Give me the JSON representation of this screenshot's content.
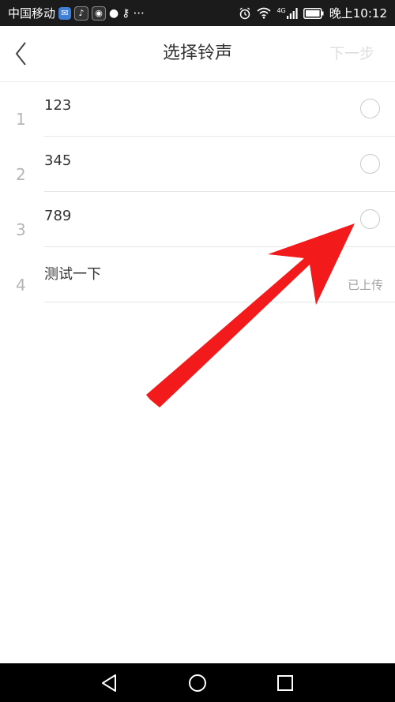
{
  "status_bar": {
    "carrier": "中国移动",
    "more": "···",
    "network": "4G",
    "time": "晚上10:12"
  },
  "header": {
    "title": "选择铃声",
    "next_label": "下一步"
  },
  "ringtones": [
    {
      "index": "1",
      "name": "123",
      "status": ""
    },
    {
      "index": "2",
      "name": "345",
      "status": ""
    },
    {
      "index": "3",
      "name": "789",
      "status": ""
    },
    {
      "index": "4",
      "name": "测试一下",
      "status": "已上传"
    }
  ],
  "colors": {
    "status_bar_bg": "#1b1b1b",
    "annotation_arrow": "#f21a1a",
    "next_disabled": "#dedede"
  }
}
